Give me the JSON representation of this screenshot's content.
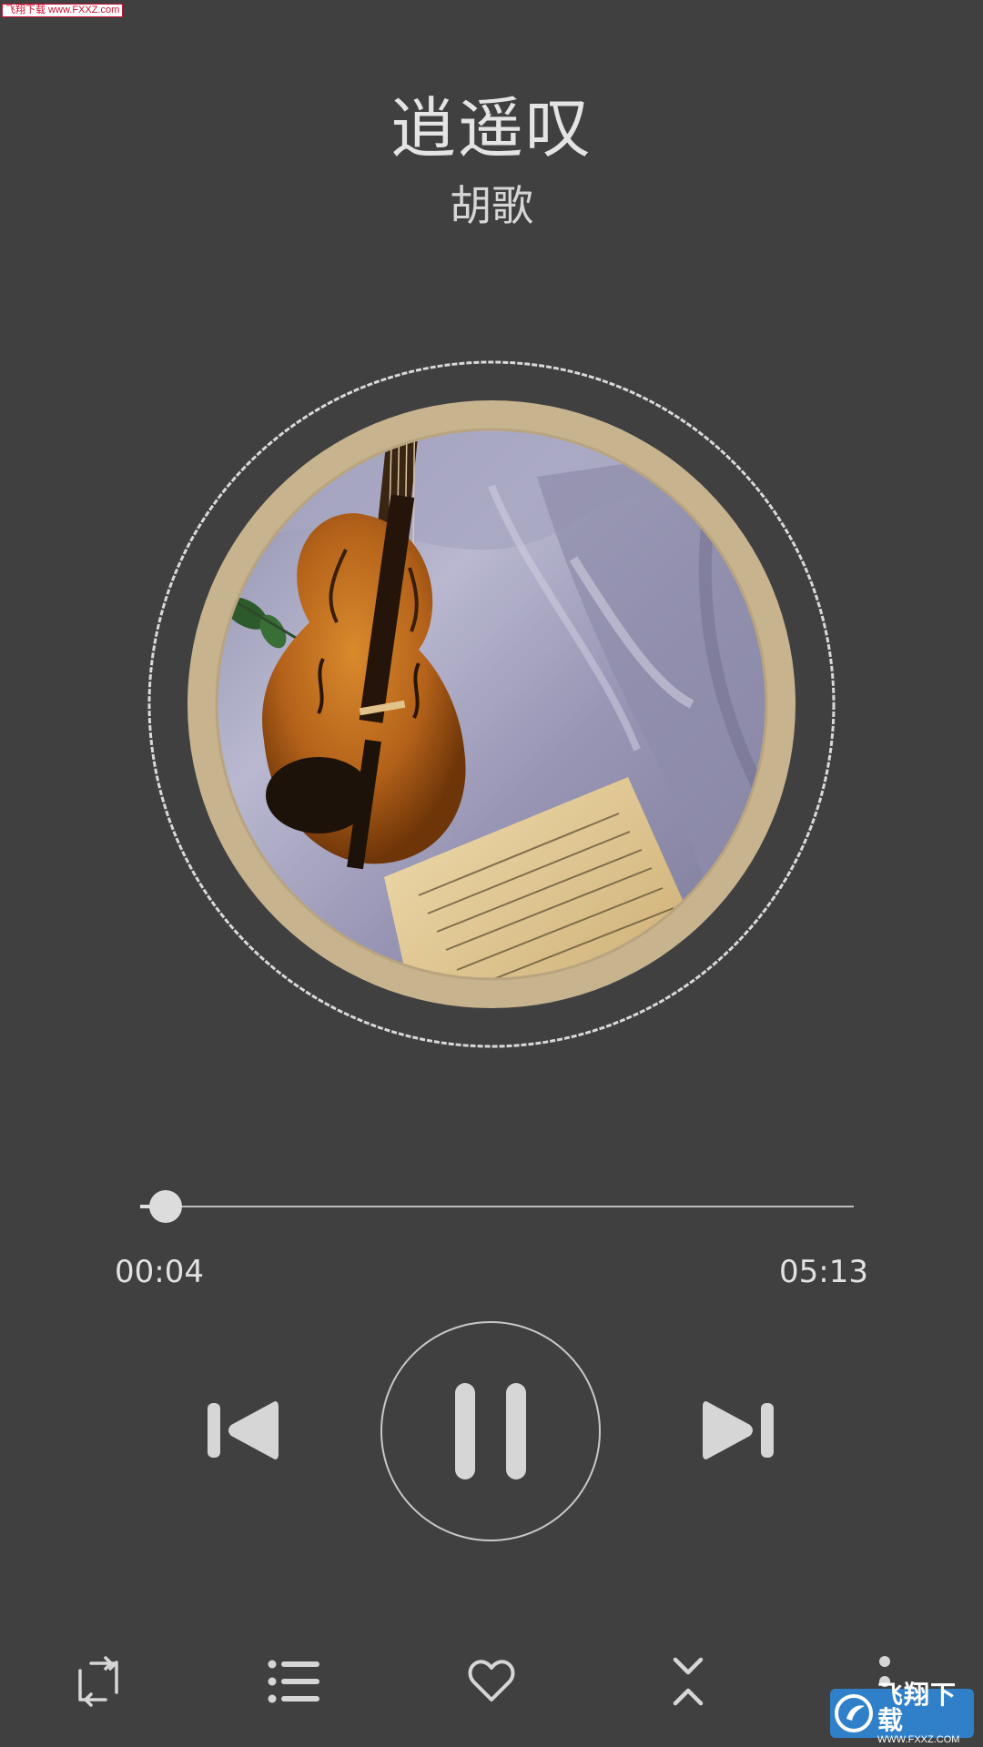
{
  "watermark": {
    "top_text": "飞翔下载 www.FXXZ.com",
    "bottom_name": "飞翔下载",
    "bottom_url": "WWW.FXXZ.COM"
  },
  "song": {
    "title": "逍遥叹",
    "artist": "胡歌"
  },
  "album_art": {
    "icon": "violin-album-art",
    "ring_color": "#c7b48f"
  },
  "playback": {
    "current_time": "00:04",
    "total_time": "05:13",
    "progress_fraction": 0.0128,
    "state": "playing"
  },
  "controls": {
    "previous_icon": "skip-previous-icon",
    "pause_icon": "pause-icon",
    "next_icon": "skip-next-icon"
  },
  "bottom_bar": [
    {
      "icon": "repeat-icon"
    },
    {
      "icon": "playlist-icon"
    },
    {
      "icon": "heart-icon"
    },
    {
      "icon": "collapse-icon"
    },
    {
      "icon": "more-vert-icon"
    }
  ],
  "colors": {
    "background": "#404040",
    "foreground": "#dcdcdc"
  }
}
